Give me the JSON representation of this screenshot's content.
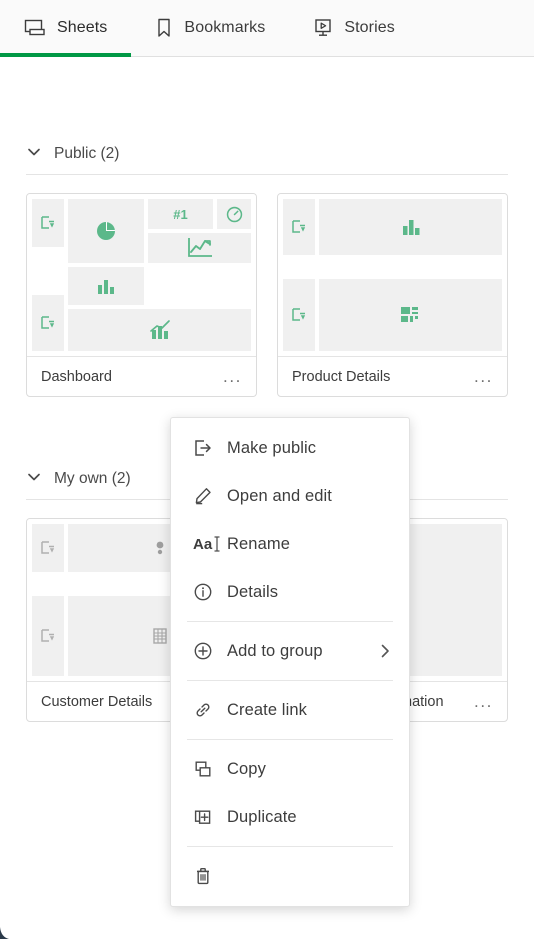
{
  "tabs": [
    {
      "label": "Sheets",
      "icon": "sheets-icon",
      "active": true
    },
    {
      "label": "Bookmarks",
      "icon": "bookmark-icon",
      "active": false
    },
    {
      "label": "Stories",
      "icon": "stories-icon",
      "active": false
    }
  ],
  "sections": [
    {
      "title": "Public (2)",
      "cards": [
        {
          "name": "Dashboard",
          "menu_label": "...",
          "accent": "#5cb88a",
          "tiles": [
            {
              "icon": "filter-pane-icon",
              "region": "left"
            },
            {
              "icon": "filter-pane-icon",
              "region": "left"
            },
            {
              "icon": "pie-chart-icon",
              "region": "main"
            },
            {
              "icon": "kpi-text-icon",
              "region": "main",
              "text": "#1"
            },
            {
              "icon": "gauge-icon",
              "region": "main"
            },
            {
              "icon": "bar-chart-icon",
              "region": "main"
            },
            {
              "icon": "line-chart-icon",
              "region": "main"
            },
            {
              "icon": "combo-chart-icon",
              "region": "main"
            }
          ]
        },
        {
          "name": "Product Details",
          "menu_label": "...",
          "accent": "#5cb88a",
          "tiles": [
            {
              "icon": "filter-pane-icon",
              "region": "left"
            },
            {
              "icon": "filter-pane-icon",
              "region": "left"
            },
            {
              "icon": "bar-chart-icon",
              "region": "main"
            },
            {
              "icon": "treemap-icon",
              "region": "main"
            }
          ]
        }
      ]
    },
    {
      "title": "My own (2)",
      "cards": [
        {
          "name": "Customer Details",
          "menu_label": "...",
          "accent": "#b8b8b8",
          "tiles": [
            {
              "icon": "filter-pane-icon",
              "region": "left"
            },
            {
              "icon": "filter-pane-icon",
              "region": "left"
            },
            {
              "icon": "scatter-plot-icon",
              "region": "main"
            },
            {
              "icon": "table-icon",
              "region": "main"
            }
          ]
        },
        {
          "name": "Geographic Information",
          "menu_label": "...",
          "accent": "#b8b8b8",
          "tiles": [
            {
              "icon": "map-globe-icon",
              "region": "main"
            }
          ]
        }
      ]
    }
  ],
  "context_menu": {
    "items": [
      {
        "label": "Make public",
        "icon": "make-public-icon",
        "submenu": false
      },
      {
        "label": "Open and edit",
        "icon": "pencil-icon",
        "submenu": false
      },
      {
        "label": "Rename",
        "icon": "rename-aa-icon",
        "submenu": false
      },
      {
        "label": "Details",
        "icon": "info-circle-icon",
        "submenu": false
      },
      {
        "separator": true
      },
      {
        "label": "Add to group",
        "icon": "plus-circle-icon",
        "submenu": true,
        "chevron": "›"
      },
      {
        "separator": true
      },
      {
        "label": "Create link",
        "icon": "link-icon",
        "submenu": false
      },
      {
        "separator": true
      },
      {
        "label": "Copy",
        "icon": "copy-icon",
        "submenu": false
      },
      {
        "label": "Duplicate",
        "icon": "duplicate-icon",
        "submenu": false
      },
      {
        "separator": true
      },
      {
        "label": "Delete",
        "icon": "trash-icon",
        "submenu": false
      }
    ]
  },
  "colors": {
    "active_tab_underline": "#009845",
    "chart_green": "#5cb88a",
    "inactive_gray": "#b8b8b8",
    "tile_bg": "#f0f0f0",
    "text": "#3c3c3c"
  }
}
